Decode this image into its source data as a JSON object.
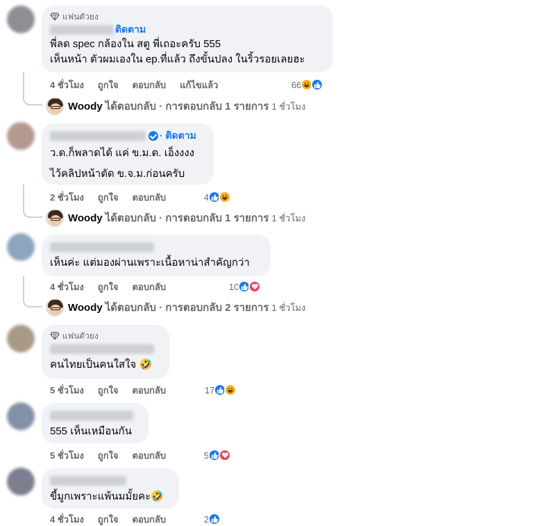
{
  "fan_badge": "แฟนตัวยง",
  "follow_label": "ติดตาม",
  "actions": {
    "like": "ถูกใจ",
    "reply": "ตอบกลับ",
    "edited": "แก้ไขแล้ว"
  },
  "colors": {
    "link": "#1877f2",
    "like": "#1877f2",
    "haha": "#f7b125",
    "love": "#f33e58",
    "muted": "#65676b",
    "bubble": "#f0f2f5"
  },
  "comments": [
    {
      "fan": true,
      "follow": "ติดตาม",
      "lines": [
        "พี่ลด spec กล้องใน สตู พี่เถอะครับ 555",
        "เห็นหน้า ตัวผมเองใน ep.ที่แล้ว ถึงขั้นปลง ในริ้วรอยเลยฮะ"
      ],
      "time": "4 ชั่วโมง",
      "edited": "แก้ไขแล้ว",
      "reaction_count": "66",
      "reactions": [
        "haha-icon",
        "like-icon"
      ],
      "reply": {
        "name": "Woody",
        "text": "ได้ตอบกลับ · การตอบกลับ 1 รายการ",
        "time": "1 ชั่วโมง"
      }
    },
    {
      "fan": false,
      "follow": "· ติดตาม",
      "lines": [
        "ว.ด.ก็พลาดได้ แค่ ข.ม.ต. เอ็งงงง",
        "ไว้คลิปหน้าตัด ข.จ.ม.ก่อนครับ"
      ],
      "time": "2 ชั่วโมง",
      "reaction_count": "4",
      "reactions": [
        "like-icon",
        "haha-icon"
      ],
      "reply": {
        "name": "Woody",
        "text": "ได้ตอบกลับ · การตอบกลับ 1 รายการ",
        "time": "1 ชั่วโมง"
      }
    },
    {
      "fan": false,
      "lines": [
        "เห็นค่ะ แต่มองผ่านเพราะเนื้อหาน่าสำคัญกว่า"
      ],
      "time": "4 ชั่วโมง",
      "reaction_count": "10",
      "reactions": [
        "like-icon",
        "love-icon"
      ],
      "reply": {
        "name": "Woody",
        "text": "ได้ตอบกลับ · การตอบกลับ 2 รายการ",
        "time": "1 ชั่วโมง"
      }
    },
    {
      "fan": true,
      "lines": [
        "คนไทยเป็นคนใสใจ 🤣"
      ],
      "time": "5 ชั่วโมง",
      "reaction_count": "17",
      "reactions": [
        "like-icon",
        "haha-icon"
      ]
    },
    {
      "fan": false,
      "lines": [
        "555 เห็นเหมือนกัน"
      ],
      "time": "5 ชั่วโมง",
      "reaction_count": "5",
      "reactions": [
        "like-icon",
        "love-icon"
      ]
    },
    {
      "fan": false,
      "lines": [
        "ขี้มูกเพราะแพ้นมมั้ยคะ🤣"
      ],
      "time": "4 ชั่วโมง",
      "reaction_count": "2",
      "reactions": [
        "like-icon"
      ]
    }
  ]
}
